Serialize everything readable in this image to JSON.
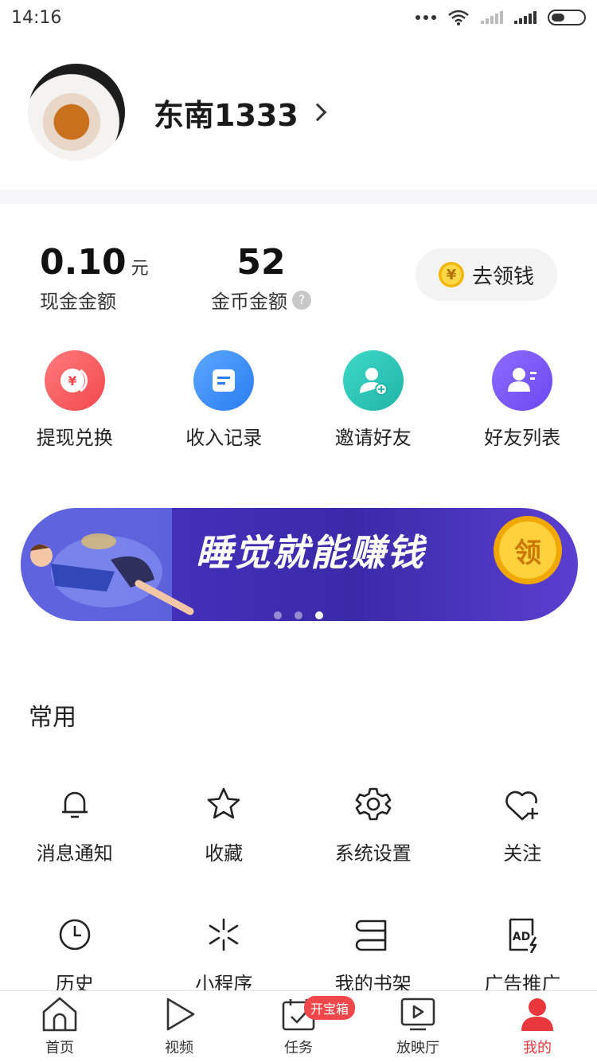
{
  "status_bar": {
    "time": "14:16"
  },
  "profile": {
    "username": "东南1333"
  },
  "wallet": {
    "cash_amount": "0.10",
    "cash_unit": "元",
    "cash_label": "现金金额",
    "coin_amount": "52",
    "coin_label": "金币金额",
    "help_symbol": "?",
    "get_money_label": "去领钱",
    "coin_symbol": "¥"
  },
  "quick_actions": [
    {
      "label": "提现兑换",
      "icon": "withdraw-icon",
      "color": "#f2484e"
    },
    {
      "label": "收入记录",
      "icon": "income-record-icon",
      "color": "#2b7cf0"
    },
    {
      "label": "邀请好友",
      "icon": "invite-friend-icon",
      "color": "#1fb5a8"
    },
    {
      "label": "好友列表",
      "icon": "friend-list-icon",
      "color": "#6b48f0"
    }
  ],
  "banner": {
    "text": "睡觉就能赚钱",
    "coin_text": "领",
    "slide_count": 3,
    "active_slide": 3
  },
  "common": {
    "title": "常用",
    "items": [
      {
        "label": "消息通知",
        "icon": "bell-icon"
      },
      {
        "label": "收藏",
        "icon": "star-icon"
      },
      {
        "label": "系统设置",
        "icon": "gear-icon"
      },
      {
        "label": "关注",
        "icon": "heart-plus-icon"
      },
      {
        "label": "历史",
        "icon": "clock-icon"
      },
      {
        "label": "小程序",
        "icon": "mini-program-icon"
      },
      {
        "label": "我的书架",
        "icon": "bookshelf-icon"
      },
      {
        "label": "广告推广",
        "icon": "ad-icon"
      }
    ]
  },
  "tabbar": {
    "items": [
      {
        "label": "首页",
        "icon": "home-icon"
      },
      {
        "label": "视频",
        "icon": "play-icon"
      },
      {
        "label": "任务",
        "icon": "task-icon",
        "badge": "开宝箱"
      },
      {
        "label": "放映厅",
        "icon": "cinema-icon"
      },
      {
        "label": "我的",
        "icon": "profile-icon",
        "active": true
      }
    ]
  },
  "colors": {
    "accent": "#e8383d"
  }
}
